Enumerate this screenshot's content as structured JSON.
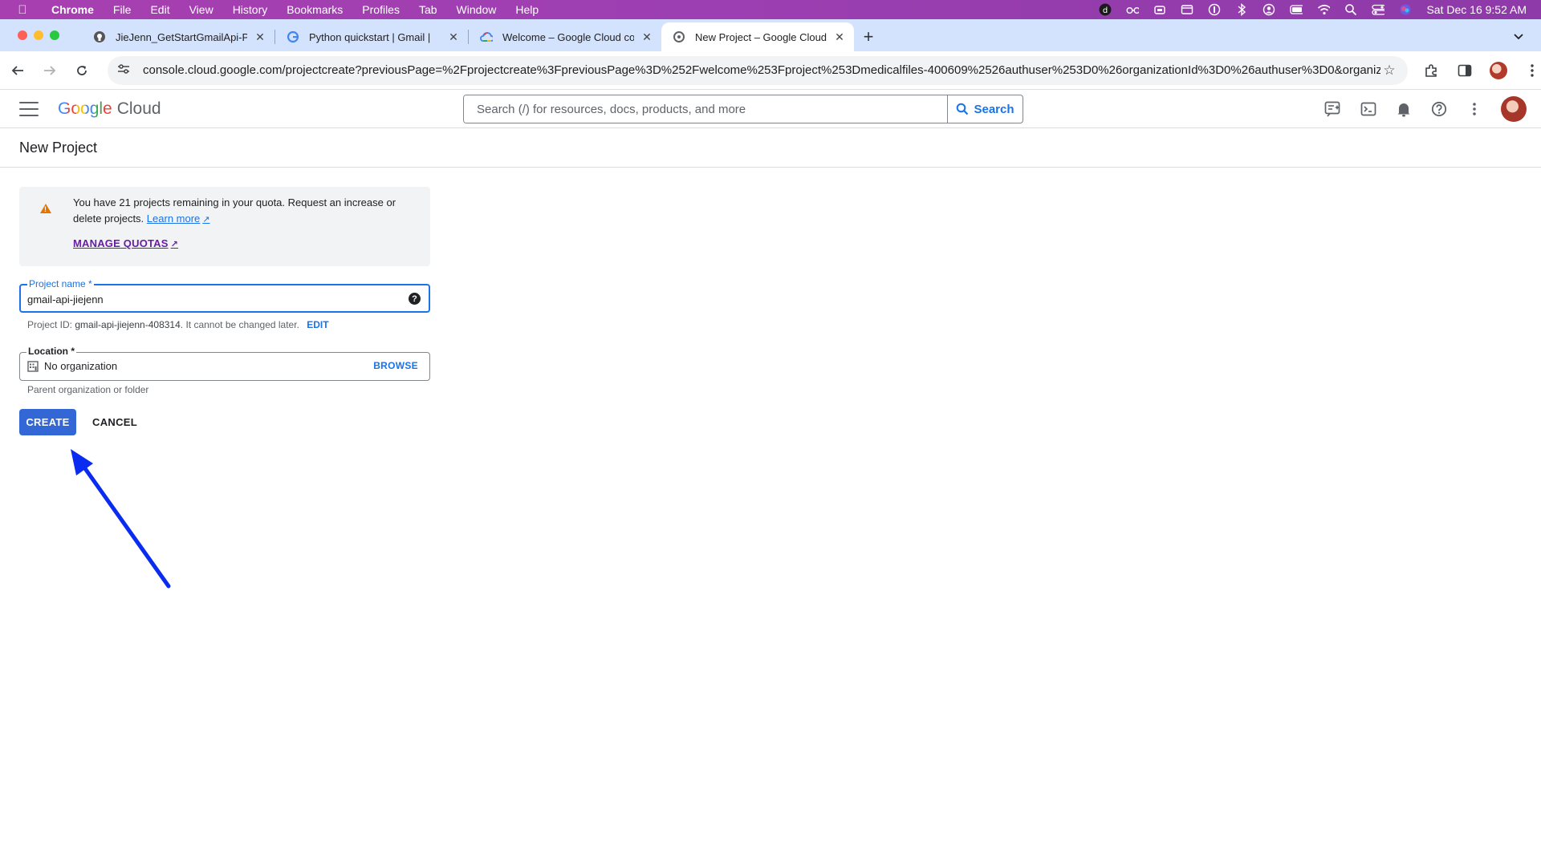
{
  "menubar": {
    "app": "Chrome",
    "items": [
      "File",
      "Edit",
      "View",
      "History",
      "Bookmarks",
      "Profiles",
      "Tab",
      "Window",
      "Help"
    ],
    "clock": "Sat Dec 16  9:52 AM"
  },
  "tabs": [
    {
      "title": "JieJenn_GetStartGmailApi-Py",
      "favicon": "github-icon"
    },
    {
      "title": "Python quickstart  |  Gmail  |",
      "favicon": "google-icon"
    },
    {
      "title": "Welcome – Google Cloud con",
      "favicon": "google-cloud-icon"
    },
    {
      "title": "New Project – Google Cloud c",
      "favicon": "google-cloud-icon",
      "active": true
    }
  ],
  "toolbar": {
    "url": "console.cloud.google.com/projectcreate?previousPage=%2Fprojectcreate%3FpreviousPage%3D%252Fwelcome%253Fproject%253Dmedicalfiles-400609%2526authuser%253D0%26organizationId%3D0%26authuser%3D0&organiz..."
  },
  "gc_header": {
    "logo_google": "Google",
    "logo_cloud": "Cloud",
    "search_placeholder": "Search (/) for resources, docs, products, and more",
    "search_button": "Search"
  },
  "page": {
    "title": "New Project"
  },
  "quota": {
    "message": "You have 21 projects remaining in your quota. Request an increase or delete projects.",
    "learn_more": "Learn more",
    "manage_quotas": "MANAGE QUOTAS"
  },
  "form": {
    "project_name_label": "Project name *",
    "project_name_value": "gmail-api-jiejenn",
    "project_id_prefix": "Project ID:",
    "project_id": "gmail-api-jiejenn-408314",
    "project_id_suffix": ". It cannot be changed later.",
    "edit_label": "EDIT",
    "location_label": "Location *",
    "location_value": "No organization",
    "browse_label": "BROWSE",
    "location_helper": "Parent organization or folder"
  },
  "actions": {
    "create": "CREATE",
    "cancel": "CANCEL"
  },
  "colors": {
    "primary_blue": "#1a73e8",
    "create_button": "#3367d6",
    "warning": "#e37400",
    "annotation_arrow": "#0a2cf0"
  }
}
